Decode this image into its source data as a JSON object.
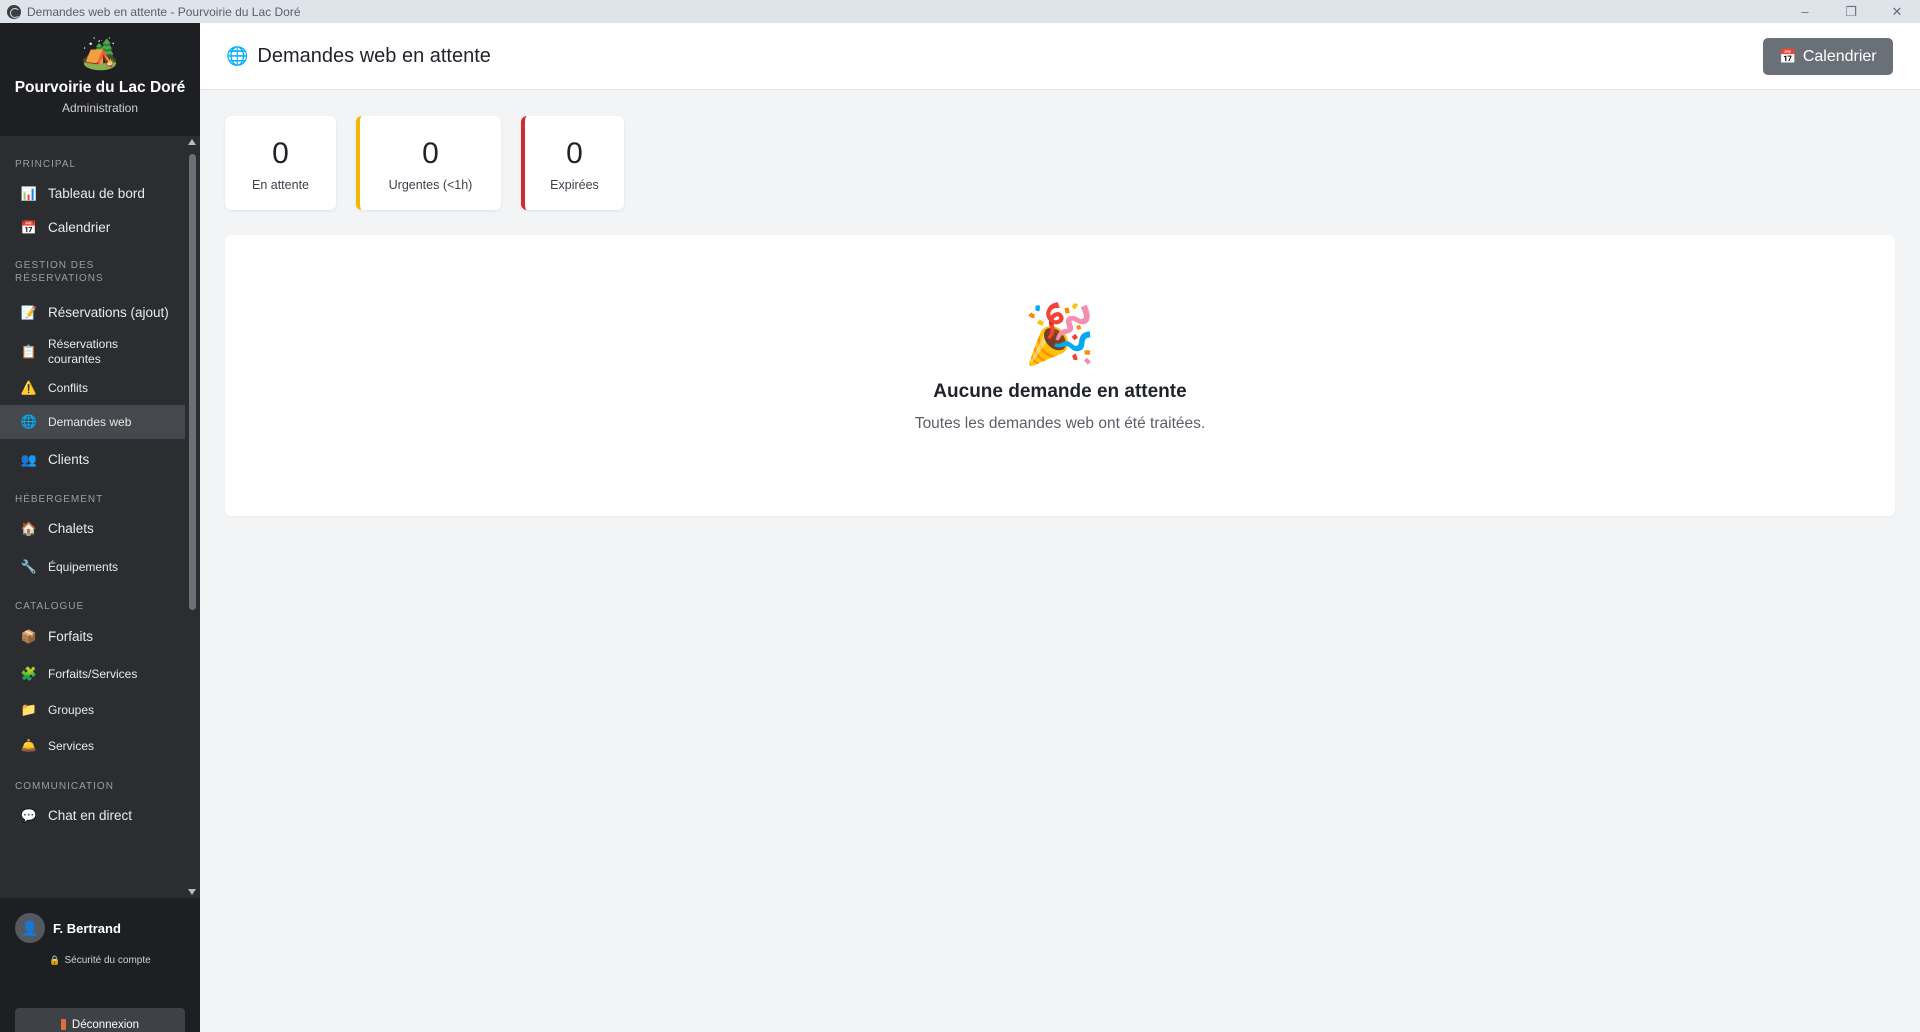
{
  "window": {
    "title": "Demandes web en attente - Pourvoirie du Lac Doré",
    "controls": {
      "minimize": "–",
      "restore": "❐",
      "close": "✕"
    }
  },
  "brand": {
    "logo_icon": "🏕️",
    "name": "Pourvoirie du Lac Doré",
    "subtitle": "Administration"
  },
  "sidebar": {
    "sections": [
      {
        "label": "PRINCIPAL",
        "items": [
          {
            "icon": "📊",
            "label": "Tableau de bord",
            "active": false
          },
          {
            "icon": "📅",
            "label": "Calendrier",
            "active": false
          }
        ]
      },
      {
        "label": "GESTION DES RÉSERVATIONS",
        "items": [
          {
            "icon": "📝",
            "label": "Réservations (ajout)",
            "active": false
          },
          {
            "icon": "📋",
            "label": "Réservations courantes",
            "active": false
          },
          {
            "icon": "⚠️",
            "label": "Conflits",
            "active": false
          },
          {
            "icon": "🌐",
            "label": "Demandes web",
            "active": true
          },
          {
            "icon": "👥",
            "label": "Clients",
            "active": false
          }
        ]
      },
      {
        "label": "HÉBERGEMENT",
        "items": [
          {
            "icon": "🏠",
            "label": "Chalets",
            "active": false
          },
          {
            "icon": "🔧",
            "label": "Équipements",
            "active": false
          }
        ]
      },
      {
        "label": "CATALOGUE",
        "items": [
          {
            "icon": "📦",
            "label": "Forfaits",
            "active": false
          },
          {
            "icon": "🧩",
            "label": "Forfaits/Services",
            "active": false
          },
          {
            "icon": "📁",
            "label": "Groupes",
            "active": false
          },
          {
            "icon": "🛎️",
            "label": "Services",
            "active": false
          }
        ]
      },
      {
        "label": "COMMUNICATION",
        "items": [
          {
            "icon": "💬",
            "label": "Chat en direct",
            "active": false
          }
        ]
      }
    ]
  },
  "user": {
    "avatar_icon": "👤",
    "name": "F. Bertrand",
    "security_icon": "🔒",
    "security_label": "Sécurité du compte",
    "logout_label": "Déconnexion"
  },
  "header": {
    "title_icon": "🌐",
    "title": "Demandes web en attente",
    "calendar_button_icon": "📅",
    "calendar_button": "Calendrier"
  },
  "stats": [
    {
      "value": "0",
      "label": "En attente",
      "accent": ""
    },
    {
      "value": "0",
      "label": "Urgentes (<1h)",
      "accent": "#f2b705"
    },
    {
      "value": "0",
      "label": "Expirées",
      "accent": "#cf2e2e"
    }
  ],
  "empty_state": {
    "icon": "🎉",
    "title": "Aucune demande en attente",
    "message": "Toutes les demandes web ont été traitées."
  }
}
